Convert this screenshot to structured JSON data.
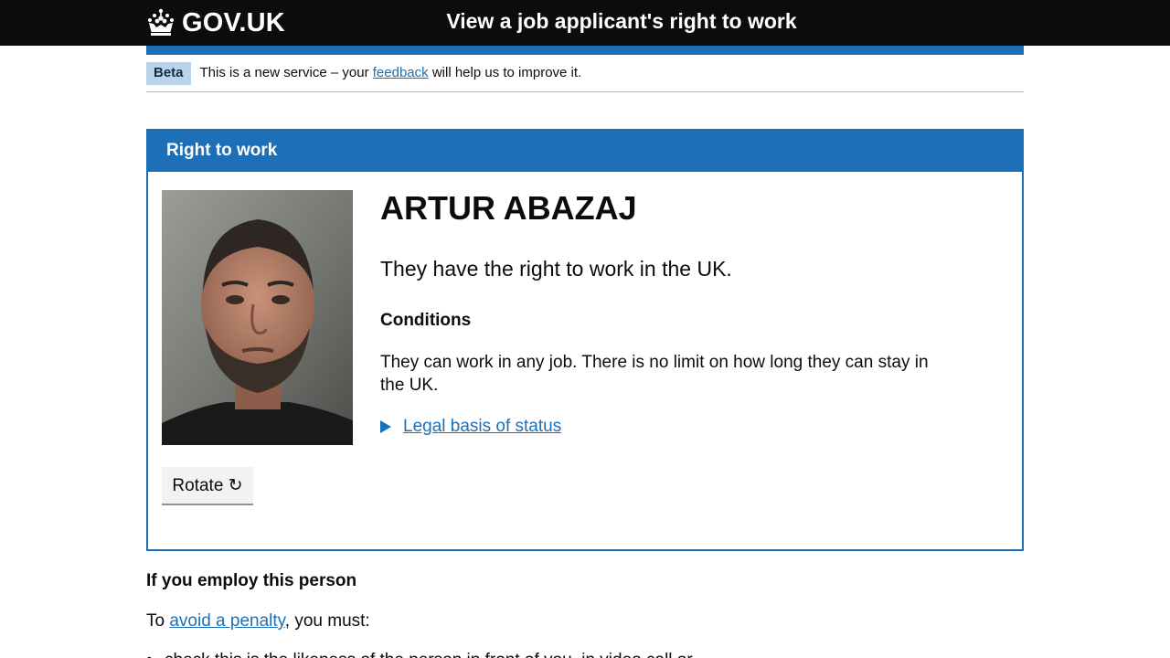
{
  "header": {
    "logo_text": "GOV.UK",
    "service_name": "View a job applicant's right to work"
  },
  "phase_banner": {
    "tag": "Beta",
    "text_before": "This is a new service – your ",
    "link": "feedback",
    "text_after": " will help us to improve it."
  },
  "panel": {
    "title": "Right to work",
    "name": "ARTUR ABAZAJ",
    "status": "They have the right to work in the UK.",
    "conditions_heading": "Conditions",
    "conditions_text": "They can work in any job. There is no limit on how long they can stay in the UK.",
    "legal_link": "Legal basis of status",
    "rotate_button": "Rotate ↻"
  },
  "employ": {
    "heading": "If you employ this person",
    "intro_before": "To ",
    "intro_link": "avoid a penalty",
    "intro_after": ", you must:",
    "first_item": "check this is the likeness of the person in front of you, in video call or"
  },
  "colors": {
    "header_bg": "#0b0c0c",
    "brand_blue": "#1d70b8",
    "tag_bg": "#bbd4ea",
    "button_bg": "#f3f2f1"
  }
}
